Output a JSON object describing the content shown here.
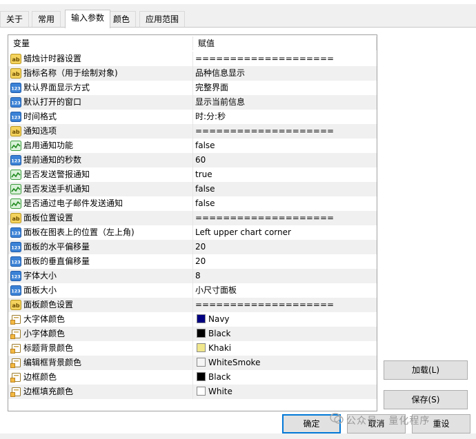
{
  "tabs": [
    {
      "label": "关于",
      "active": false
    },
    {
      "label": "常用",
      "active": false
    },
    {
      "label": "输入参数",
      "active": true
    },
    {
      "label": "颜色",
      "active": false
    },
    {
      "label": "应用范围",
      "active": false
    }
  ],
  "table": {
    "col_variable": "变量",
    "col_value": "赋值",
    "rows": [
      {
        "type": "string",
        "icon": "ab-string-icon",
        "label": "蜡烛计时器设置",
        "value": "===================="
      },
      {
        "type": "string",
        "icon": "ab-string-icon",
        "label": "指标名称（用于绘制对象)",
        "value": "品种信息显示"
      },
      {
        "type": "int",
        "icon": "123-number-icon",
        "label": "默认界面显示方式",
        "value": "完整界面"
      },
      {
        "type": "int",
        "icon": "123-number-icon",
        "label": "默认打开的窗口",
        "value": "显示当前信息"
      },
      {
        "type": "int",
        "icon": "123-number-icon",
        "label": "时间格式",
        "value": "时:分:秒"
      },
      {
        "type": "string",
        "icon": "ab-string-icon",
        "label": "通知选项",
        "value": "===================="
      },
      {
        "type": "bool",
        "icon": "bool-icon",
        "label": "启用通知功能",
        "value": "false"
      },
      {
        "type": "int",
        "icon": "123-number-icon",
        "label": "提前通知的秒数",
        "value": "60"
      },
      {
        "type": "bool",
        "icon": "bool-icon",
        "label": "是否发送警报通知",
        "value": "true"
      },
      {
        "type": "bool",
        "icon": "bool-icon",
        "label": "是否发送手机通知",
        "value": "false"
      },
      {
        "type": "bool",
        "icon": "bool-icon",
        "label": "是否通过电子邮件发送通知",
        "value": "false"
      },
      {
        "type": "string",
        "icon": "ab-string-icon",
        "label": "面板位置设置",
        "value": "===================="
      },
      {
        "type": "int",
        "icon": "123-number-icon",
        "label": "面板在图表上的位置（左上角)",
        "value": "Left upper chart corner"
      },
      {
        "type": "int",
        "icon": "123-number-icon",
        "label": "面板的水平偏移量",
        "value": "20"
      },
      {
        "type": "int",
        "icon": "123-number-icon",
        "label": "面板的垂直偏移量",
        "value": "20"
      },
      {
        "type": "int",
        "icon": "123-number-icon",
        "label": "字体大小",
        "value": "8"
      },
      {
        "type": "int",
        "icon": "123-number-icon",
        "label": "面板大小",
        "value": "小尺寸面板"
      },
      {
        "type": "string",
        "icon": "ab-string-icon",
        "label": "面板颜色设置",
        "value": "===================="
      },
      {
        "type": "color",
        "icon": "color-icon",
        "label": "大字体颜色",
        "value": "Navy",
        "swatch": "#000080"
      },
      {
        "type": "color",
        "icon": "color-icon",
        "label": "小字体颜色",
        "value": "Black",
        "swatch": "#000000"
      },
      {
        "type": "color",
        "icon": "color-icon",
        "label": "标题背景颜色",
        "value": "Khaki",
        "swatch": "#f0e68c"
      },
      {
        "type": "color",
        "icon": "color-icon",
        "label": "编辑框背景颜色",
        "value": "WhiteSmoke",
        "swatch": "#f5f5f5"
      },
      {
        "type": "color",
        "icon": "color-icon",
        "label": "边框颜色",
        "value": "Black",
        "swatch": "#000000"
      },
      {
        "type": "color",
        "icon": "color-icon",
        "label": "边框填充颜色",
        "value": "White",
        "swatch": "#ffffff"
      }
    ]
  },
  "buttons": {
    "load": "加载(L)",
    "save": "保存(S)",
    "ok": "确定",
    "cancel": "取消",
    "reset": "重设"
  },
  "watermark": "公众号 · 量化程序"
}
